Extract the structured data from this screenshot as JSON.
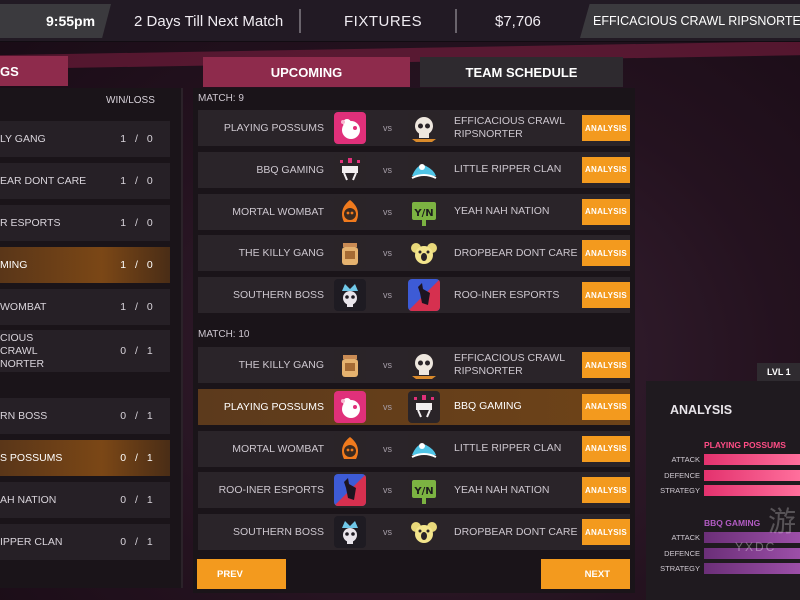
{
  "topbar": {
    "time": "9:55pm",
    "countdown": "2 Days Till Next Match",
    "screen_title": "FIXTURES",
    "money": "$7,706",
    "team_name": "EFFICACIOUS CRAWL RIPSNORTER"
  },
  "standings": {
    "tab_label": "GS",
    "col_winloss": "WIN/LOSS",
    "rows": [
      {
        "team": "LY GANG",
        "wl": "1 / 0"
      },
      {
        "team": "EAR DONT CARE",
        "wl": "1 / 0"
      },
      {
        "team": "R ESPORTS",
        "wl": "1 / 0"
      },
      {
        "team": "MING",
        "wl": "1 / 0"
      },
      {
        "team": "WOMBAT",
        "wl": "1 / 0"
      },
      {
        "team": "CIOUS CRAWL NORTER",
        "wl": "0 / 1"
      },
      {
        "team": "RN BOSS",
        "wl": "0 / 1"
      },
      {
        "team": "S POSSUMS",
        "wl": "0 / 1"
      },
      {
        "team": "AH NATION",
        "wl": "0 / 1"
      },
      {
        "team": "IPPER CLAN",
        "wl": "0 / 1"
      }
    ]
  },
  "tabs": {
    "upcoming": "UPCOMING",
    "team_schedule": "TEAM SCHEDULE"
  },
  "matches": [
    {
      "label": "MATCH: 9",
      "fixtures": [
        {
          "home": "PLAYING POSSUMS",
          "home_icon": "possum-icon",
          "away": "EFFICACIOUS CRAWL RIPSNORTER",
          "away_icon": "skull-icon",
          "vs": "vs",
          "button": "ANALYSIS"
        },
        {
          "home": "BBQ GAMING",
          "home_icon": "bbq-grill-icon",
          "away": "LITTLE RIPPER CLAN",
          "away_icon": "wave-icon",
          "vs": "vs",
          "button": "ANALYSIS"
        },
        {
          "home": "MORTAL WOMBAT",
          "home_icon": "wombat-flame-icon",
          "away": "YEAH NAH NATION",
          "away_icon": "yn-sign-icon",
          "vs": "vs",
          "button": "ANALYSIS"
        },
        {
          "home": "THE KILLY GANG",
          "home_icon": "jar-icon",
          "away": "DROPBEAR DONT CARE",
          "away_icon": "koala-icon",
          "vs": "vs",
          "button": "ANALYSIS"
        },
        {
          "home": "SOUTHERN BOSS",
          "home_icon": "crown-skull-icon",
          "away": "ROO-INER ESPORTS",
          "away_icon": "kangaroo-icon",
          "vs": "vs",
          "button": "ANALYSIS"
        }
      ]
    },
    {
      "label": "MATCH: 10",
      "fixtures": [
        {
          "home": "THE KILLY GANG",
          "home_icon": "jar-icon",
          "away": "EFFICACIOUS CRAWL RIPSNORTER",
          "away_icon": "skull-icon",
          "vs": "vs",
          "button": "ANALYSIS"
        },
        {
          "home": "PLAYING POSSUMS",
          "home_icon": "possum-icon",
          "away": "BBQ GAMING",
          "away_icon": "bbq-grill-icon",
          "vs": "vs",
          "button": "ANALYSIS",
          "selected": true
        },
        {
          "home": "MORTAL WOMBAT",
          "home_icon": "wombat-flame-icon",
          "away": "LITTLE RIPPER CLAN",
          "away_icon": "wave-icon",
          "vs": "vs",
          "button": "ANALYSIS"
        },
        {
          "home": "ROO-INER ESPORTS",
          "home_icon": "kangaroo-icon",
          "away": "YEAH NAH NATION",
          "away_icon": "yn-sign-icon",
          "vs": "vs",
          "button": "ANALYSIS"
        },
        {
          "home": "SOUTHERN BOSS",
          "home_icon": "crown-skull-icon",
          "away": "DROPBEAR DONT CARE",
          "away_icon": "koala-icon",
          "vs": "vs",
          "button": "ANALYSIS"
        }
      ]
    }
  ],
  "nav": {
    "prev": "PREV",
    "next": "NEXT"
  },
  "analysis": {
    "level": "LVL 1",
    "title": "ANALYSIS",
    "teams": [
      {
        "name": "PLAYING POSSUMS",
        "color": "#ff4d86",
        "stats": [
          {
            "label": "ATTACK",
            "value": 1.0
          },
          {
            "label": "DEFENCE",
            "value": 1.0
          },
          {
            "label": "STRATEGY",
            "value": 1.0
          }
        ]
      },
      {
        "name": "BBQ GAMING",
        "color": "#b35cc4",
        "stats": [
          {
            "label": "ATTACK",
            "value": 1.0
          },
          {
            "label": "DEFENCE",
            "value": 1.0
          },
          {
            "label": "STRATEGY",
            "value": 1.0
          }
        ]
      }
    ]
  },
  "colors": {
    "accent": "#8e2b4c",
    "button": "#f39a1e",
    "highlight": "#6e4318"
  }
}
